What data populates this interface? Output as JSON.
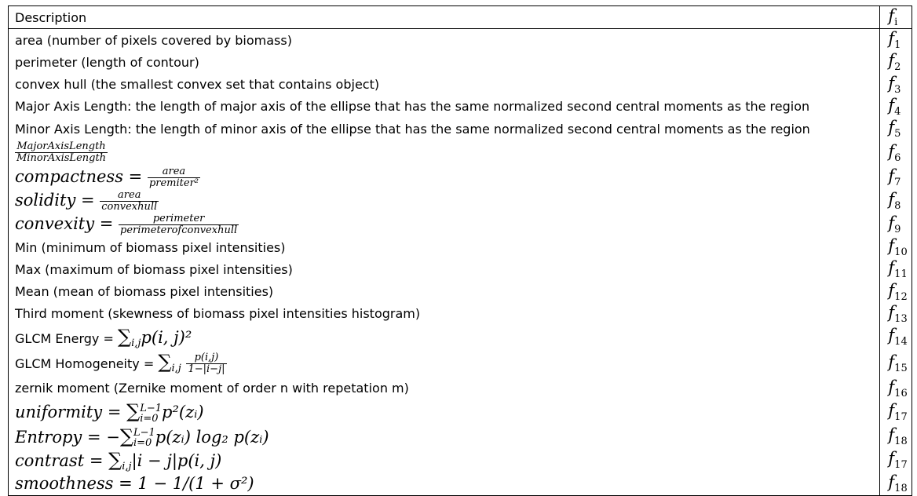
{
  "header": {
    "description": "Description",
    "fi": "f",
    "fi_sub": "i"
  },
  "rows": [
    {
      "text": "area (number of pixels covered by biomass)",
      "sub": "1",
      "h": 28
    },
    {
      "text": "perimeter (length of contour)",
      "sub": "2",
      "h": 28
    },
    {
      "text": "convex hull (the smallest convex set that contains object)",
      "sub": "3",
      "h": 27
    },
    {
      "text": "Major Axis Length: the length of major axis of the ellipse that has the same normalized second central moments as the region",
      "sub": "4",
      "h": 28
    },
    {
      "text": "Minor Axis Length: the length of minor axis of the ellipse that has the same normalized second central moments as the region",
      "sub": "5",
      "h": 28
    },
    {
      "num": "MajorAxisLength",
      "den": "MinorAxisLength",
      "sub": "6",
      "h": 33
    },
    {
      "lhs": "compactness",
      "num": "area",
      "den": "premiter²",
      "sub": "7",
      "h": 30
    },
    {
      "lhs": "solidity",
      "num": "area",
      "den": "convexhull",
      "sub": "8",
      "h": 30
    },
    {
      "lhs": "convexity",
      "num": "perimeter",
      "den": "perimeterofconvexhull",
      "sub": "9",
      "h": 30
    },
    {
      "text": "Min (minimum of biomass pixel intensities)",
      "sub": "10",
      "h": 27
    },
    {
      "text": "Max (maximum of biomass pixel intensities)",
      "sub": "11",
      "h": 28
    },
    {
      "text": "Mean (mean of biomass pixel intensities)",
      "sub": "12",
      "h": 28
    },
    {
      "text": "Third moment (skewness of biomass pixel intensities histogram)",
      "sub": "13",
      "h": 28
    },
    {
      "label": "GLCM Energy = ",
      "sum": "i,j",
      "expr": "p(i, j)²",
      "sub": "14",
      "h": 31
    },
    {
      "label": "GLCM Homogeneity = ",
      "sum": "i,j",
      "num": "p(i,j)",
      "den": "1−|i−j|",
      "sub": "15",
      "h": 36
    },
    {
      "text": "zernik moment (Zernike moment of order n with repetation m)",
      "sub": "16",
      "h": 28
    },
    {
      "lhs": "uniformity",
      "sum": "i=0",
      "sup": "L−1",
      "expr": "p²(zᵢ)",
      "sub": "17",
      "h": 32
    },
    {
      "lhs": "Entropy",
      "neg": "−",
      "sum": "i=0",
      "sup": "L−1",
      "expr": "p(zᵢ) log₂ p(zᵢ)",
      "sub": "18",
      "h": 31
    },
    {
      "lhs": "contrast",
      "sum": "i,j",
      "expr": "|i − j|p(i, j)",
      "sub": "17",
      "h": 29
    },
    {
      "lhs": "smoothness",
      "expr": "1 − 1/(1 + σ²)",
      "sub": "18",
      "h": 30
    }
  ]
}
